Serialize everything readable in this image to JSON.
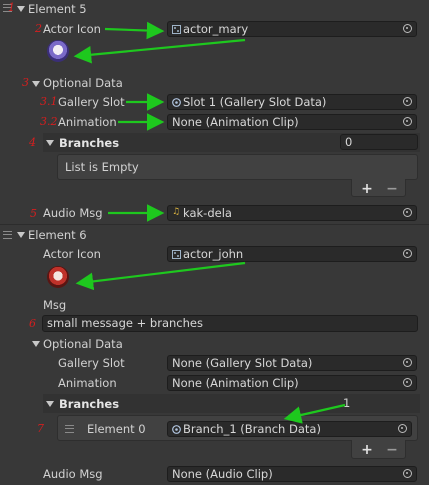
{
  "element5": {
    "marker": "1",
    "header": "Element 5",
    "actor_icon": {
      "marker": "2",
      "label": "Actor Icon",
      "value": "actor_mary"
    },
    "optional_data": {
      "marker": "3",
      "label": "Optional Data",
      "gallery_slot": {
        "marker": "3.1",
        "label": "Gallery Slot",
        "value": "Slot 1 (Gallery Slot Data)"
      },
      "animation": {
        "marker": "3.2",
        "label": "Animation",
        "value": "None (Animation Clip)"
      }
    },
    "branches": {
      "marker": "4",
      "label": "Branches",
      "count": "0",
      "empty_text": "List is Empty",
      "add": "+",
      "remove": "−"
    },
    "audio_msg": {
      "marker": "5",
      "label": "Audio Msg",
      "value": "kak-dela"
    }
  },
  "element6": {
    "header": "Element 6",
    "actor_icon": {
      "label": "Actor Icon",
      "value": "actor_john"
    },
    "msg": {
      "marker": "6",
      "label": "Msg",
      "value": "small message + branches"
    },
    "optional_data": {
      "label": "Optional Data",
      "gallery_slot": {
        "label": "Gallery Slot",
        "value": "None (Gallery Slot Data)"
      },
      "animation": {
        "label": "Animation",
        "value": "None (Animation Clip)"
      }
    },
    "branches": {
      "marker": "7",
      "label": "Branches",
      "count": "1",
      "items": [
        {
          "label": "Element 0",
          "value": "Branch_1 (Branch Data)"
        }
      ],
      "add": "+",
      "remove": "−"
    },
    "audio_msg": {
      "label": "Audio Msg",
      "value": "None (Audio Clip)"
    }
  },
  "colors": {
    "annotation_red": "#d41f1f",
    "annotation_green": "#1ec81e",
    "background": "#383838",
    "field": "#2a2a2a"
  }
}
